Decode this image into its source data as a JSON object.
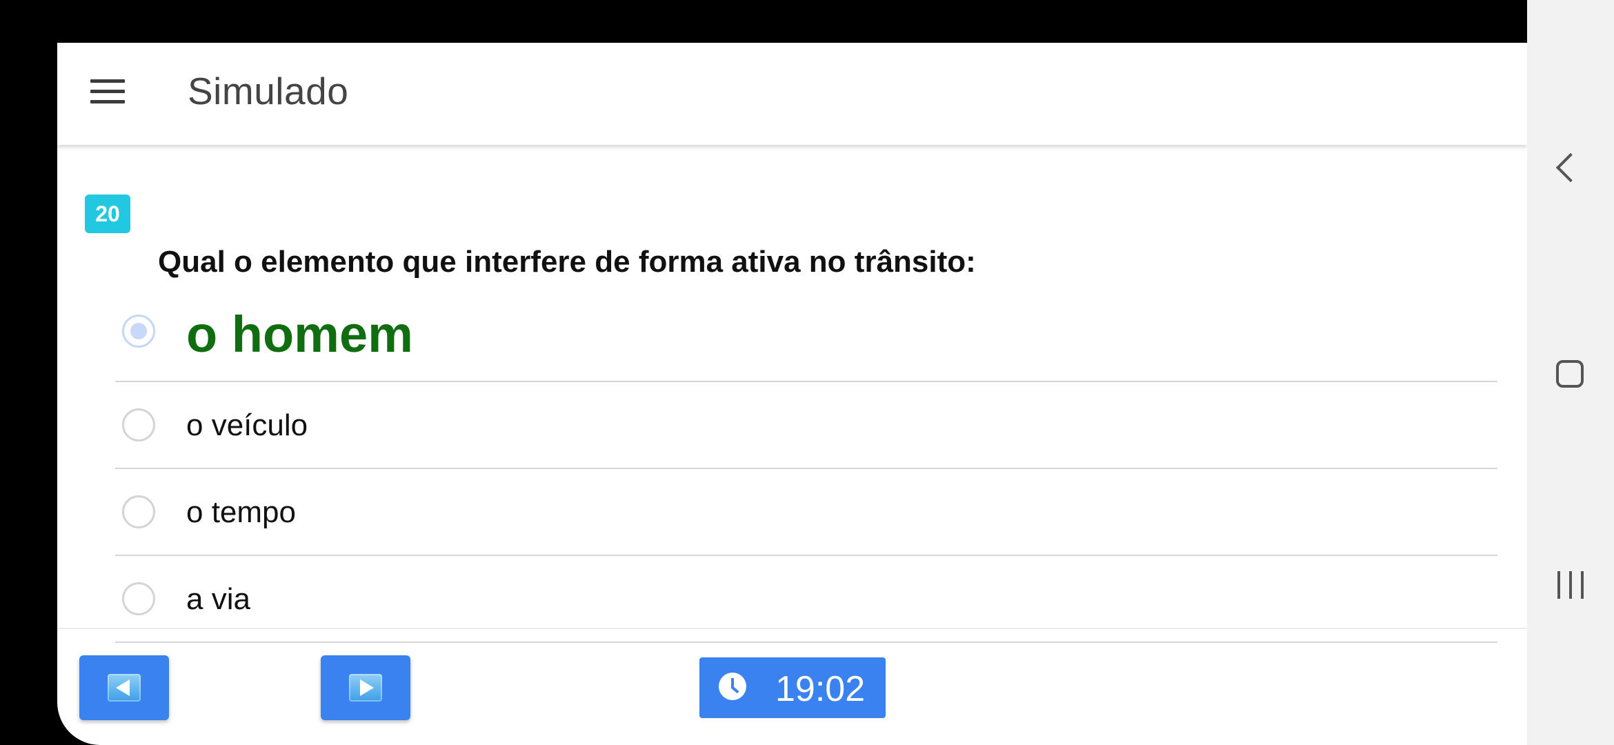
{
  "app": {
    "title": "Simulado"
  },
  "question": {
    "number": "20",
    "text": "Qual o elemento que interfere de forma ativa no trânsito:"
  },
  "options": [
    {
      "label": "o homem",
      "selected": true,
      "highlight_color": "#106e10"
    },
    {
      "label": "o veículo",
      "selected": false
    },
    {
      "label": "o tempo",
      "selected": false
    },
    {
      "label": "a via",
      "selected": false
    }
  ],
  "footer": {
    "prev_icon": "arrow-left-icon",
    "next_icon": "arrow-right-icon",
    "timer_icon": "clock-icon",
    "timer": "19:02"
  },
  "colors": {
    "accent": "#3b82f1",
    "badge": "#22c8e0",
    "correct": "#106e10"
  },
  "system_nav": {
    "back_icon": "back-icon",
    "home_icon": "home-icon",
    "recents_icon": "recents-icon"
  }
}
